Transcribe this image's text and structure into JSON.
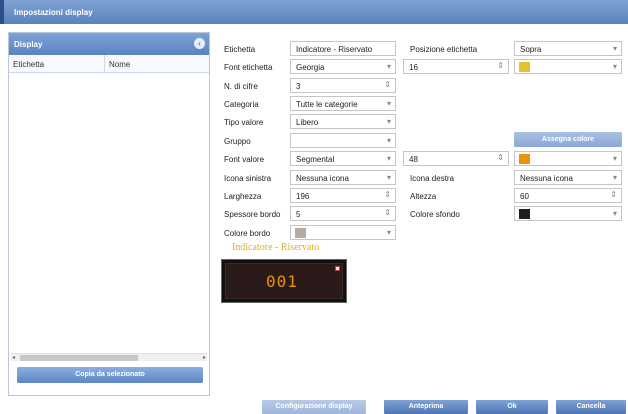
{
  "window": {
    "title": "Impostazioni display"
  },
  "left_panel": {
    "title": "Display",
    "columns": [
      "Etichetta",
      "Nome"
    ],
    "copy_button": "Copia da selezionato"
  },
  "form": {
    "etichetta": {
      "label": "Etichetta",
      "value": "Indicatore - Riservato"
    },
    "posizione_etichetta": {
      "label": "Posizione etichetta",
      "value": "Sopra"
    },
    "font_etichetta": {
      "label": "Font etichetta",
      "value": "Georgia",
      "size": "16",
      "color": "#e6c12a"
    },
    "n_cifre": {
      "label": "N. di cifre",
      "value": "3"
    },
    "categoria": {
      "label": "Categoria",
      "value": "Tutte le categorie"
    },
    "tipo_valore": {
      "label": "Tipo valore",
      "value": "Libero"
    },
    "gruppo": {
      "label": "Gruppo",
      "value": ""
    },
    "assegna_colore": "Assegna colore",
    "font_valore": {
      "label": "Font valore",
      "value": "Segmental",
      "size": "48",
      "color": "#e8940a"
    },
    "icona_sinistra": {
      "label": "Icona sinistra",
      "value": "Nessuna icona"
    },
    "icona_destra": {
      "label": "Icona destra",
      "value": "Nessuna icona"
    },
    "larghezza": {
      "label": "Larghezza",
      "value": "196"
    },
    "altezza": {
      "label": "Altezza",
      "value": "60"
    },
    "spessore_bordo": {
      "label": "Spessore bordo",
      "value": "5"
    },
    "colore_sfondo": {
      "label": "Colore sfondo",
      "color": "#1f1f1f"
    },
    "colore_bordo": {
      "label": "Colore bordo",
      "color": "#b5aaa5"
    }
  },
  "preview": {
    "title": "Indicatore - Riservato",
    "digits": "001"
  },
  "footer": {
    "config_button": "Configurazione display",
    "preview_button": "Anteprima",
    "ok_button": "Ok",
    "cancel_button": "Cancella"
  }
}
